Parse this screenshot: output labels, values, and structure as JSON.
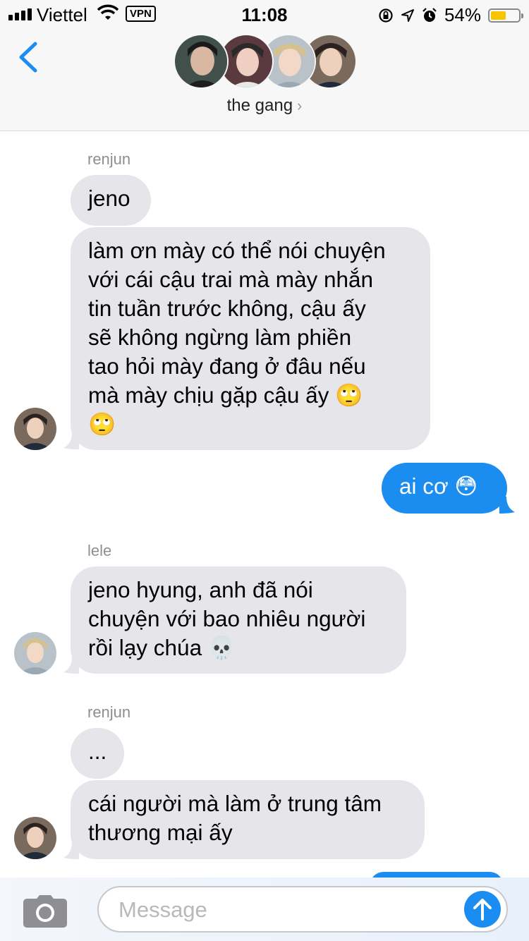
{
  "status_bar": {
    "carrier": "Viettel",
    "vpn": "VPN",
    "time": "11:08",
    "battery_percent": "54%",
    "battery_level": 0.54,
    "icons": [
      "signal-icon",
      "wifi-icon",
      "rotation-lock-icon",
      "location-icon",
      "alarm-icon",
      "battery-icon"
    ]
  },
  "header": {
    "back_icon": "chevron-left-icon",
    "group_name": "the gang",
    "chevron": "›",
    "avatar_count": 4
  },
  "colors": {
    "accent": "#1b8df0",
    "incoming_bubble": "#e5e5ea",
    "outgoing_bubble": "#1b8df0",
    "header_bg": "#f7f7f7"
  },
  "messages": [
    {
      "sender": "renjun"
    },
    {
      "text": "jeno"
    },
    {
      "text": "làm ơn mày có thể nói chuyện\nvới cái cậu trai mà mày nhắn\ntin tuần trước không, cậu ấy\nsẽ không ngừng làm phiền\ntao hỏi mày đang ở đâu nếu\nmà mày chịu gặp cậu ấy 🙄\n🙄"
    },
    {
      "text": "ai cơ 😳"
    },
    {
      "sender": "lele"
    },
    {
      "text": "jeno hyung, anh đã nói\nchuyện với bao nhiêu người\nrồi lạy chúa 💀"
    },
    {
      "sender": "renjun"
    },
    {
      "text": "..."
    },
    {
      "text": "cái người mà làm ở trung tâm\nthương mại ấy"
    }
  ],
  "composer": {
    "placeholder": "Message",
    "camera_icon": "camera-icon",
    "send_icon": "arrow-up-icon"
  }
}
